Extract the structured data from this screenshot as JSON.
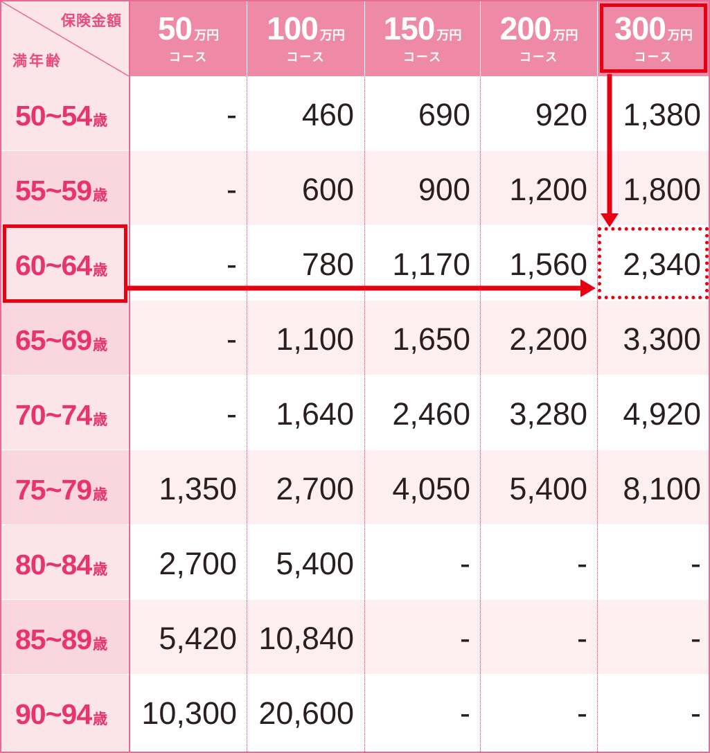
{
  "corner": {
    "top_label": "保険金額",
    "bottom_label": "満年齢"
  },
  "columns": [
    {
      "amount": "50",
      "unit": "万円",
      "course": "コース"
    },
    {
      "amount": "100",
      "unit": "万円",
      "course": "コース"
    },
    {
      "amount": "150",
      "unit": "万円",
      "course": "コース"
    },
    {
      "amount": "200",
      "unit": "万円",
      "course": "コース"
    },
    {
      "amount": "300",
      "unit": "万円",
      "course": "コース"
    }
  ],
  "rows": [
    {
      "age": "50~54",
      "unit": "歳",
      "values": [
        "-",
        "460",
        "690",
        "920",
        "1,380"
      ]
    },
    {
      "age": "55~59",
      "unit": "歳",
      "values": [
        "-",
        "600",
        "900",
        "1,200",
        "1,800"
      ]
    },
    {
      "age": "60~64",
      "unit": "歳",
      "values": [
        "-",
        "780",
        "1,170",
        "1,560",
        "2,340"
      ]
    },
    {
      "age": "65~69",
      "unit": "歳",
      "values": [
        "-",
        "1,100",
        "1,650",
        "2,200",
        "3,300"
      ]
    },
    {
      "age": "70~74",
      "unit": "歳",
      "values": [
        "-",
        "1,640",
        "2,460",
        "3,280",
        "4,920"
      ]
    },
    {
      "age": "75~79",
      "unit": "歳",
      "values": [
        "1,350",
        "2,700",
        "4,050",
        "5,400",
        "8,100"
      ]
    },
    {
      "age": "80~84",
      "unit": "歳",
      "values": [
        "2,700",
        "5,400",
        "-",
        "-",
        "-"
      ]
    },
    {
      "age": "85~89",
      "unit": "歳",
      "values": [
        "5,420",
        "10,840",
        "-",
        "-",
        "-"
      ]
    },
    {
      "age": "90~94",
      "unit": "歳",
      "values": [
        "10,300",
        "20,600",
        "-",
        "-",
        "-"
      ]
    }
  ],
  "colors": {
    "header": "#ee8aa5",
    "accent": "#e8336d",
    "highlight": "#e60012",
    "row_alt": "#fdeef2"
  }
}
